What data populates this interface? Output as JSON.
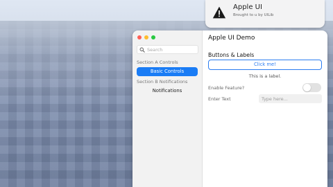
{
  "notification": {
    "title": "Apple UI",
    "subtitle": "Brought to u by UILib",
    "icon": "warning-icon"
  },
  "window": {
    "title": "Apple UI Demo",
    "traffic_lights": {
      "close": "#ff5f57",
      "minimize": "#febc2e",
      "zoom": "#28c840"
    }
  },
  "sidebar": {
    "search_placeholder": "Search",
    "sections": [
      {
        "header": "Section A Controls",
        "items": [
          {
            "label": "Basic Controls",
            "selected": true
          }
        ]
      },
      {
        "header": "Section B Notifications",
        "items": [
          {
            "label": "Notifications",
            "selected": false
          }
        ]
      }
    ]
  },
  "content": {
    "group_title": "Buttons & Labels",
    "button_label": "Click me!",
    "label_text": "This is a label.",
    "toggle_label": "Enable Feature?",
    "toggle_on": false,
    "input_label": "Enter Text",
    "input_placeholder": "Type here...",
    "input_value": ""
  },
  "colors": {
    "accent": "#1a7cf5"
  }
}
